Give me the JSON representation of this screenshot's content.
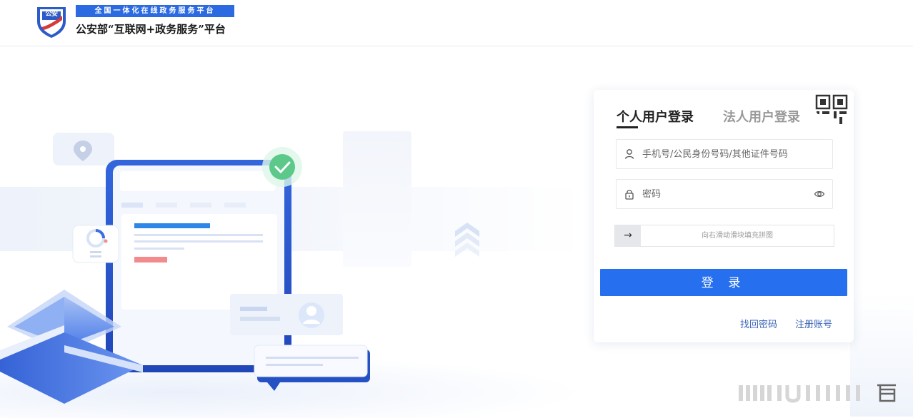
{
  "header": {
    "badge_text": "公安",
    "banner_top": "全国一体化在线政务服务平台",
    "banner_sub": "公安部“互联网+政务服务”平台"
  },
  "login": {
    "tab_personal": "个人用户登录",
    "tab_corporate": "法人用户登录",
    "account_placeholder": "手机号/公民身份号码/其他证件号码",
    "password_placeholder": "密码",
    "slider_handle": "→",
    "slider_text": "向右滑动滑块填充拼图",
    "submit_label": "登 录",
    "forgot_link": "找回密码",
    "register_link": "注册账号"
  },
  "icons": {
    "qr": "qr-code-icon",
    "user": "user-icon",
    "lock": "lock-icon",
    "eye": "eye-icon"
  },
  "colors": {
    "brand_blue": "#2670f0",
    "banner_blue": "#2b6ae0",
    "link_blue": "#3a64b8"
  }
}
